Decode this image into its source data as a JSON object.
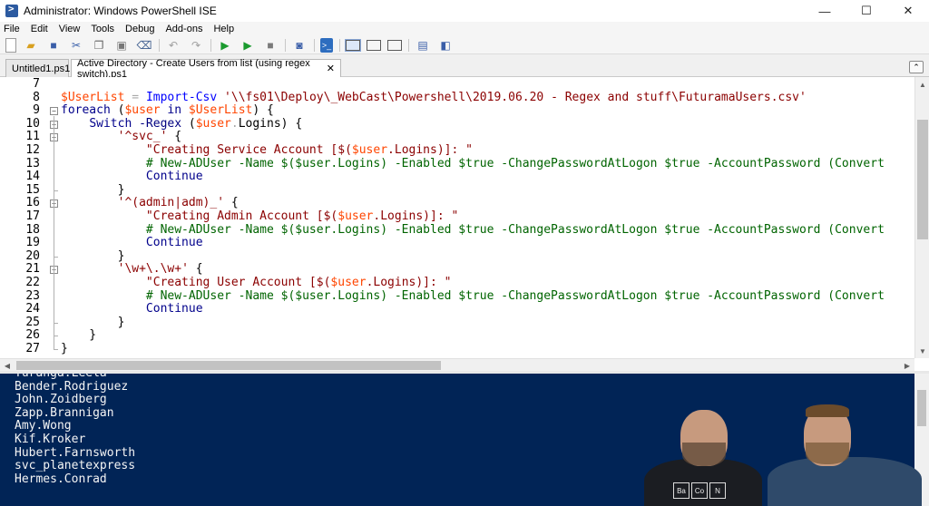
{
  "window": {
    "title": "Administrator: Windows PowerShell ISE",
    "controls": {
      "minimize": "—",
      "maximize": "☐",
      "close": "✕"
    }
  },
  "menu": [
    "File",
    "Edit",
    "View",
    "Tools",
    "Debug",
    "Add-ons",
    "Help"
  ],
  "toolbar": {
    "buttons": [
      "new-icon",
      "open-icon",
      "save-icon",
      "cut-icon",
      "copy-icon",
      "paste-icon",
      "clear-icon",
      "undo-icon",
      "redo-icon",
      "run-icon",
      "run-selection-icon",
      "stop-icon",
      "remote-powershell-icon",
      "powershell-icon",
      "layout-top-icon",
      "layout-right-icon",
      "layout-max-icon",
      "show-command-icon",
      "show-addons-icon"
    ]
  },
  "tabs": [
    {
      "label": "Untitled1.ps1",
      "active": false
    },
    {
      "label": "Active Directory - Create Users from list (using regex switch).ps1",
      "active": true,
      "close": "✕"
    }
  ],
  "collapse_glyph": "⌃",
  "editor": {
    "line_numbers": [
      "7",
      "8",
      "9",
      "10",
      "11",
      "12",
      "13",
      "14",
      "15",
      "16",
      "17",
      "18",
      "19",
      "20",
      "21",
      "22",
      "23",
      "24",
      "25",
      "26",
      "27"
    ],
    "lines": [
      [],
      [
        [
          "var",
          "$UserList"
        ],
        [
          "pln",
          " "
        ],
        [
          "op",
          "="
        ],
        [
          "pln",
          " "
        ],
        [
          "cmd",
          "Import-Csv"
        ],
        [
          "pln",
          " "
        ],
        [
          "str",
          "'\\\\fs01\\Deploy\\_WebCast\\Powershell\\2019.06.20 - Regex and stuff\\FuturamaUsers.csv'"
        ]
      ],
      [
        [
          "kw",
          "foreach"
        ],
        [
          "pln",
          " ("
        ],
        [
          "var",
          "$user"
        ],
        [
          "pln",
          " "
        ],
        [
          "kw",
          "in"
        ],
        [
          "pln",
          " "
        ],
        [
          "var",
          "$UserList"
        ],
        [
          "pln",
          ") {"
        ]
      ],
      [
        [
          "pln",
          "    "
        ],
        [
          "kw",
          "Switch"
        ],
        [
          "pln",
          " "
        ],
        [
          "prm",
          "-Regex"
        ],
        [
          "pln",
          " ("
        ],
        [
          "var",
          "$user"
        ],
        [
          "op",
          "."
        ],
        [
          "mem",
          "Logins"
        ],
        [
          "pln",
          ") {"
        ]
      ],
      [
        [
          "pln",
          "        "
        ],
        [
          "str",
          "'^svc_'"
        ],
        [
          "pln",
          " {"
        ]
      ],
      [
        [
          "pln",
          "            "
        ],
        [
          "str",
          "\"Creating Service Account [$("
        ],
        [
          "var",
          "$user"
        ],
        [
          "str",
          ".Logins)]: \""
        ]
      ],
      [
        [
          "pln",
          "            "
        ],
        [
          "cmt",
          "# New-ADUser -Name $($user.Logins) -Enabled $true -ChangePasswordAtLogon $true -AccountPassword (Convert"
        ]
      ],
      [
        [
          "pln",
          "            "
        ],
        [
          "kw",
          "Continue"
        ]
      ],
      [
        [
          "pln",
          "        }"
        ]
      ],
      [
        [
          "pln",
          "        "
        ],
        [
          "str",
          "'^(admin|adm)_'"
        ],
        [
          "pln",
          " {"
        ]
      ],
      [
        [
          "pln",
          "            "
        ],
        [
          "str",
          "\"Creating Admin Account [$("
        ],
        [
          "var",
          "$user"
        ],
        [
          "str",
          ".Logins)]: \""
        ]
      ],
      [
        [
          "pln",
          "            "
        ],
        [
          "cmt",
          "# New-ADUser -Name $($user.Logins) -Enabled $true -ChangePasswordAtLogon $true -AccountPassword (Convert"
        ]
      ],
      [
        [
          "pln",
          "            "
        ],
        [
          "kw",
          "Continue"
        ]
      ],
      [
        [
          "pln",
          "        }"
        ]
      ],
      [
        [
          "pln",
          "        "
        ],
        [
          "str",
          "'\\w+\\.\\w+'"
        ],
        [
          "pln",
          " {"
        ]
      ],
      [
        [
          "pln",
          "            "
        ],
        [
          "str",
          "\"Creating User Account [$("
        ],
        [
          "var",
          "$user"
        ],
        [
          "str",
          ".Logins)]: \""
        ]
      ],
      [
        [
          "pln",
          "            "
        ],
        [
          "cmt",
          "# New-ADUser -Name $($user.Logins) -Enabled $true -ChangePasswordAtLogon $true -AccountPassword (Convert"
        ]
      ],
      [
        [
          "pln",
          "            "
        ],
        [
          "kw",
          "Continue"
        ]
      ],
      [
        [
          "pln",
          "        }"
        ]
      ],
      [
        [
          "pln",
          "    }"
        ]
      ],
      [
        [
          "pln",
          "}"
        ]
      ]
    ]
  },
  "console": {
    "lines": [
      "Turanga.Leela",
      "Bender.Rodriguez",
      "John.Zoidberg",
      "Zapp.Brannigan",
      "Amy.Wong",
      "Kif.Kroker",
      "Hubert.Farnsworth",
      "svc_planetexpress",
      "Hermes.Conrad"
    ]
  },
  "webcam": {
    "shirt_print": [
      "Ba",
      "Co",
      "N"
    ]
  },
  "colors": {
    "console_bg": "#012456",
    "variable": "#ff4500",
    "command": "#0000ff",
    "string": "#8b0000",
    "keyword": "#00008b",
    "comment": "#006400"
  }
}
